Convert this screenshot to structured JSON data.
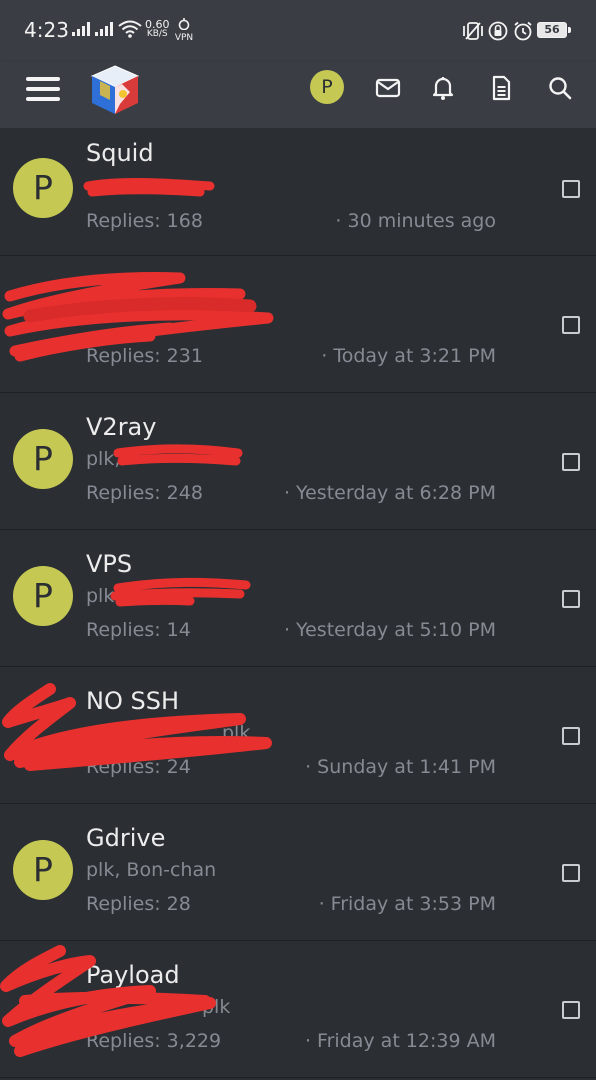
{
  "status_bar": {
    "time": "4:23",
    "speed_value": "0.60",
    "speed_unit": "KB/S",
    "vpn_label": "VPN",
    "battery": "56"
  },
  "app_bar": {
    "avatar_letter": "P",
    "icons": [
      "menu-icon",
      "app-logo",
      "mail-icon",
      "bell-icon",
      "document-icon",
      "search-icon"
    ]
  },
  "threads": [
    {
      "title": "Squid",
      "participants": "",
      "replies": "Replies: 168",
      "time": "· 30 minutes ago",
      "avatar": "P",
      "redacted": true
    },
    {
      "title": "",
      "participants": "",
      "replies": "Replies: 231",
      "time": "· Today at 3:21 PM",
      "avatar": "",
      "redacted": true
    },
    {
      "title": "V2ray",
      "participants": "plk,",
      "replies": "Replies: 248",
      "time": "· Yesterday at 6:28 PM",
      "avatar": "P",
      "redacted": true
    },
    {
      "title": "VPS",
      "participants": "plk,",
      "replies": "Replies: 14",
      "time": "· Yesterday at 5:10 PM",
      "avatar": "P",
      "redacted": true
    },
    {
      "title": "NO SSH",
      "participants": "plk",
      "replies": "Replies: 24",
      "time": "· Sunday at 1:41 PM",
      "avatar": "",
      "redacted": true
    },
    {
      "title": "Gdrive",
      "participants": "plk, Bon-chan",
      "replies": "Replies: 28",
      "time": "· Friday at 3:53 PM",
      "avatar": "P",
      "redacted": false
    },
    {
      "title": "Payload",
      "participants": "plk",
      "replies": "Replies: 3,229",
      "time": "· Friday at 12:39 AM",
      "avatar": "",
      "redacted": true
    }
  ],
  "colors": {
    "background": "#2b2e33",
    "header": "#3a3d44",
    "avatar": "#c5c954",
    "muted_text": "#868a93",
    "redaction": "#e8312f"
  }
}
